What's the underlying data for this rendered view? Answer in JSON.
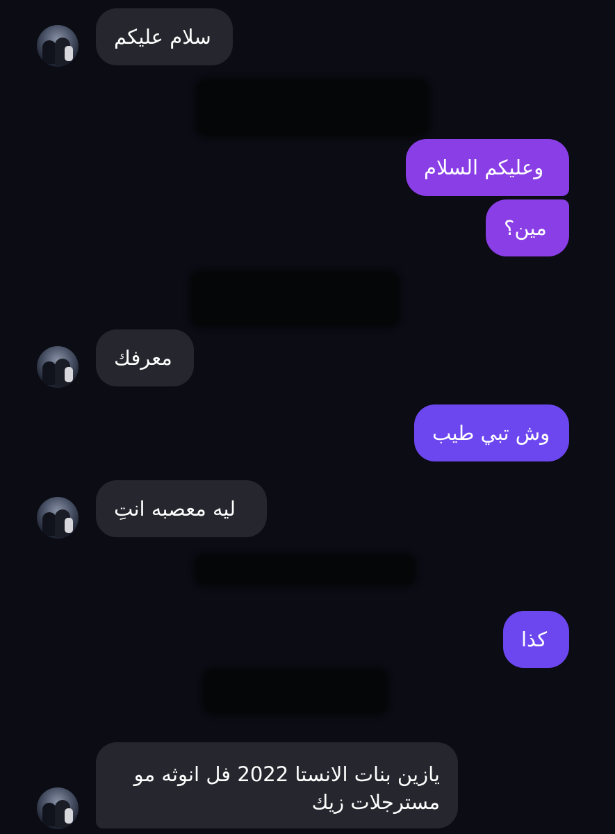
{
  "conversation": {
    "messages": [
      {
        "sender": "contact",
        "text": "سلام عليكم"
      },
      {
        "sender": "me",
        "text": "وعليكم السلام"
      },
      {
        "sender": "me",
        "text": "مين؟"
      },
      {
        "sender": "contact",
        "text": "معرفك"
      },
      {
        "sender": "me",
        "text": "وش تبي طيب"
      },
      {
        "sender": "contact",
        "text": "ليه معصبه انتِ"
      },
      {
        "sender": "me",
        "text": "كذا"
      },
      {
        "sender": "contact",
        "text_lines": [
          "يازين بنات الانستا 2022 فل انوثه مو",
          "مسترجلات زيك"
        ]
      }
    ]
  },
  "colors": {
    "background": "#0b0c14",
    "incoming_bubble": "#26272e",
    "outgoing_bubble_purple": "#8a3ee6",
    "outgoing_bubble_violet": "#6c47f0",
    "text": "#ffffff"
  },
  "icons": {
    "contact_avatar": "profile-photo-avatar"
  }
}
